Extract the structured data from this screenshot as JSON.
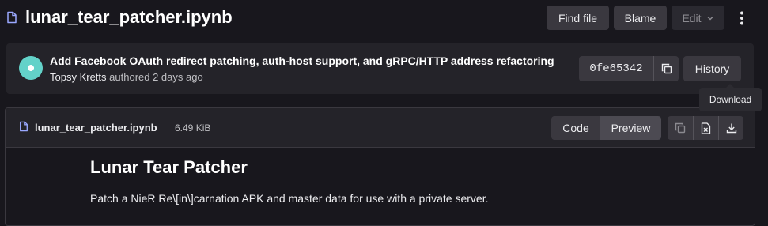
{
  "header": {
    "file_title": "lunar_tear_patcher.ipynb",
    "find_file_label": "Find file",
    "blame_label": "Blame",
    "edit_label": "Edit"
  },
  "commit": {
    "message": "Add Facebook OAuth redirect patching, auth-host support, and gRPC/HTTP address refactoring",
    "author": "Topsy Kretts",
    "authored_text": "authored 2 days ago",
    "sha": "0fe65342",
    "history_label": "History"
  },
  "tooltip": {
    "text": "Download"
  },
  "file": {
    "name": "lunar_tear_patcher.ipynb",
    "size": "6.49 KiB",
    "code_label": "Code",
    "preview_label": "Preview"
  },
  "notebook": {
    "heading": "Lunar Tear Patcher",
    "paragraph": "Patch a NieR Re\\[in\\]carnation APK and master data for use with a private server."
  },
  "icons": {
    "file": "file-icon",
    "chevron": "chevron-down-icon",
    "more": "kebab-menu-icon",
    "copy": "copy-icon",
    "open_raw": "open-raw-icon",
    "download": "download-icon"
  },
  "colors": {
    "background": "#18171d",
    "panel": "#242329",
    "button": "#3a383f",
    "button_active": "#4c4a52",
    "avatar": "#63d2c9"
  }
}
